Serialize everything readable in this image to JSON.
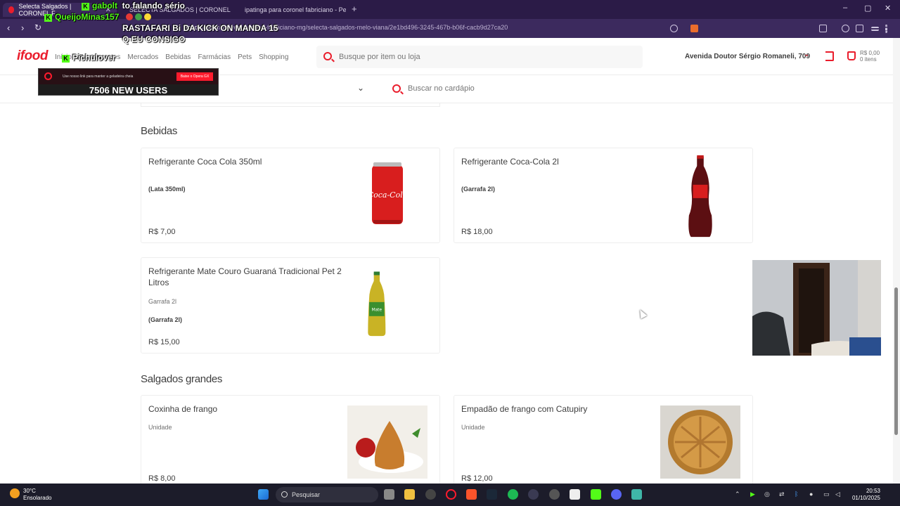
{
  "browser": {
    "tabs": [
      {
        "title": "Selecta Salgados | CORONEL F...",
        "active": true
      },
      {
        "title": "SELECTA SALGADOS | CORONEL FABRICIANO",
        "active": false
      },
      {
        "title": "ipatinga para coronel fabriciano - Pe...",
        "active": false
      }
    ],
    "new_tab": "+",
    "url_host": "ifood.com.br",
    "url_path": "/delivery/coronel-fabriciano-mg/selecta-salgados-melo-viana/2e1bd496-3245-467b-b06f-cacb9d27ca20",
    "window_controls": {
      "minimize": "–",
      "maximize": "▢",
      "close": "✕"
    }
  },
  "overlay": {
    "chat": [
      {
        "user": "gabolt",
        "message": "to falando sério"
      },
      {
        "user": "QueijoMinas157",
        "message": ""
      },
      {
        "user": "",
        "message": "RASTAFARI Bi DA KICK ON MANDA 15 Q EU CONSIGO"
      },
      {
        "user": "Pichulover",
        "message": ""
      }
    ],
    "banner_text": "Use nosso link para manter a geladeira cheia",
    "banner_button": "Baixe o Opera GX",
    "new_users": "7506 NEW USERS"
  },
  "header": {
    "logo": "ifood",
    "nav": [
      "Início",
      "Restaurantes",
      "Mercados",
      "Bebidas",
      "Farmácias",
      "Pets",
      "Shopping"
    ],
    "search_placeholder": "Busque por item ou loja",
    "address": "Avenida Doutor Sérgio Romaneli, 709",
    "cart_value": "R$ 0,00",
    "cart_items": "0 itens"
  },
  "subheader": {
    "menu_search_placeholder": "Buscar no cardápio"
  },
  "sections": [
    {
      "title": "Bebidas",
      "items": [
        {
          "name": "Refrigerante Coca Cola 350ml",
          "description": "",
          "detail": "(Lata 350ml)",
          "price": "R$ 7,00",
          "image": "coca-cola-can"
        },
        {
          "name": "Refrigerante Coca-Cola 2l",
          "description": "",
          "detail": "(Garrafa 2l)",
          "price": "R$ 18,00",
          "image": "coca-cola-bottle"
        },
        {
          "name": "Refrigerante Mate Couro Guaraná Tradicional Pet 2 Litros",
          "description": "Garrafa 2l",
          "detail": "(Garrafa 2l)",
          "price": "R$ 15,00",
          "image": "mate-couro-bottle"
        }
      ]
    },
    {
      "title": "Salgados grandes",
      "items": [
        {
          "name": "Coxinha de frango",
          "description": "Unidade",
          "detail": "",
          "price": "R$ 8,00",
          "image": "coxinha"
        },
        {
          "name": "Empadão de frango com Catupiry",
          "description": "Unidade",
          "detail": "",
          "price": "R$ 12,00",
          "image": "empadao"
        }
      ]
    }
  ],
  "taskbar": {
    "weather_temp": "30°C",
    "weather_desc": "Ensolarado",
    "search_label": "Pesquisar",
    "time": "20:53",
    "date": "01/10/2025"
  },
  "colors": {
    "brand": "#ea1d2c",
    "browser_bg": "#2b1b47",
    "kick_green": "#53fc18"
  }
}
